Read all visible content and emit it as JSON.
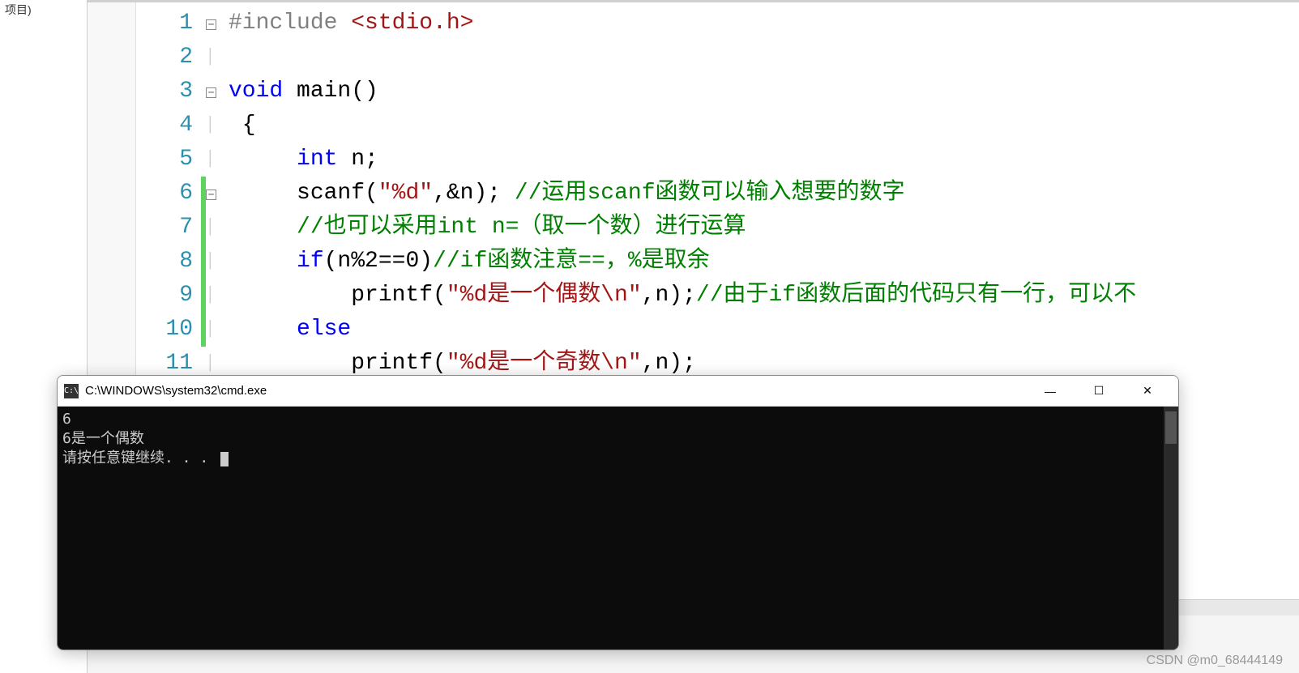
{
  "left_panel": {
    "label": "项目)"
  },
  "code": {
    "lines": [
      {
        "num": "1",
        "fold": "⊟",
        "changed": false,
        "tokens": [
          {
            "t": "preproc",
            "v": "#include "
          },
          {
            "t": "string",
            "v": "<stdio.h>"
          }
        ]
      },
      {
        "num": "2",
        "fold": "",
        "changed": false,
        "tokens": []
      },
      {
        "num": "3",
        "fold": "⊟",
        "changed": false,
        "tokens": [
          {
            "t": "keyword",
            "v": "void"
          },
          {
            "t": "plain",
            "v": " main()"
          }
        ]
      },
      {
        "num": "4",
        "fold": "",
        "changed": false,
        "tokens": [
          {
            "t": "plain",
            "v": " {"
          }
        ]
      },
      {
        "num": "5",
        "fold": "",
        "changed": false,
        "tokens": [
          {
            "t": "plain",
            "v": "     "
          },
          {
            "t": "keyword",
            "v": "int"
          },
          {
            "t": "plain",
            "v": " n;"
          }
        ]
      },
      {
        "num": "6",
        "fold": "⊟",
        "changed": true,
        "tokens": [
          {
            "t": "plain",
            "v": "     scanf("
          },
          {
            "t": "string",
            "v": "\"%d\""
          },
          {
            "t": "plain",
            "v": ",&n); "
          },
          {
            "t": "comment",
            "v": "//运用scanf函数可以输入想要的数字"
          }
        ]
      },
      {
        "num": "7",
        "fold": "",
        "changed": true,
        "tokens": [
          {
            "t": "plain",
            "v": "     "
          },
          {
            "t": "comment",
            "v": "//也可以采用int n=（取一个数）进行运算"
          }
        ]
      },
      {
        "num": "8",
        "fold": "",
        "changed": true,
        "tokens": [
          {
            "t": "plain",
            "v": "     "
          },
          {
            "t": "keyword",
            "v": "if"
          },
          {
            "t": "plain",
            "v": "(n%2==0)"
          },
          {
            "t": "comment",
            "v": "//if函数注意==，%是取余"
          }
        ]
      },
      {
        "num": "9",
        "fold": "",
        "changed": true,
        "tokens": [
          {
            "t": "plain",
            "v": "         printf("
          },
          {
            "t": "string",
            "v": "\"%d是一个偶数\\n\""
          },
          {
            "t": "plain",
            "v": ",n);"
          },
          {
            "t": "comment",
            "v": "//由于if函数后面的代码只有一行，可以不"
          }
        ]
      },
      {
        "num": "10",
        "fold": "",
        "changed": true,
        "tokens": [
          {
            "t": "plain",
            "v": "     "
          },
          {
            "t": "keyword",
            "v": "else"
          }
        ]
      },
      {
        "num": "11",
        "fold": "",
        "changed": false,
        "tokens": [
          {
            "t": "plain",
            "v": "         printf("
          },
          {
            "t": "string",
            "v": "\"%d是一个奇数\\n\""
          },
          {
            "t": "plain",
            "v": ",n);"
          }
        ]
      }
    ]
  },
  "console": {
    "title": "C:\\WINDOWS\\system32\\cmd.exe",
    "icon_label": "C:\\",
    "output": [
      "6",
      "6是一个偶数",
      "请按任意键继续. . . "
    ],
    "controls": {
      "min": "—",
      "max": "☐",
      "close": "✕"
    }
  },
  "watermark": "CSDN @m0_68444149"
}
